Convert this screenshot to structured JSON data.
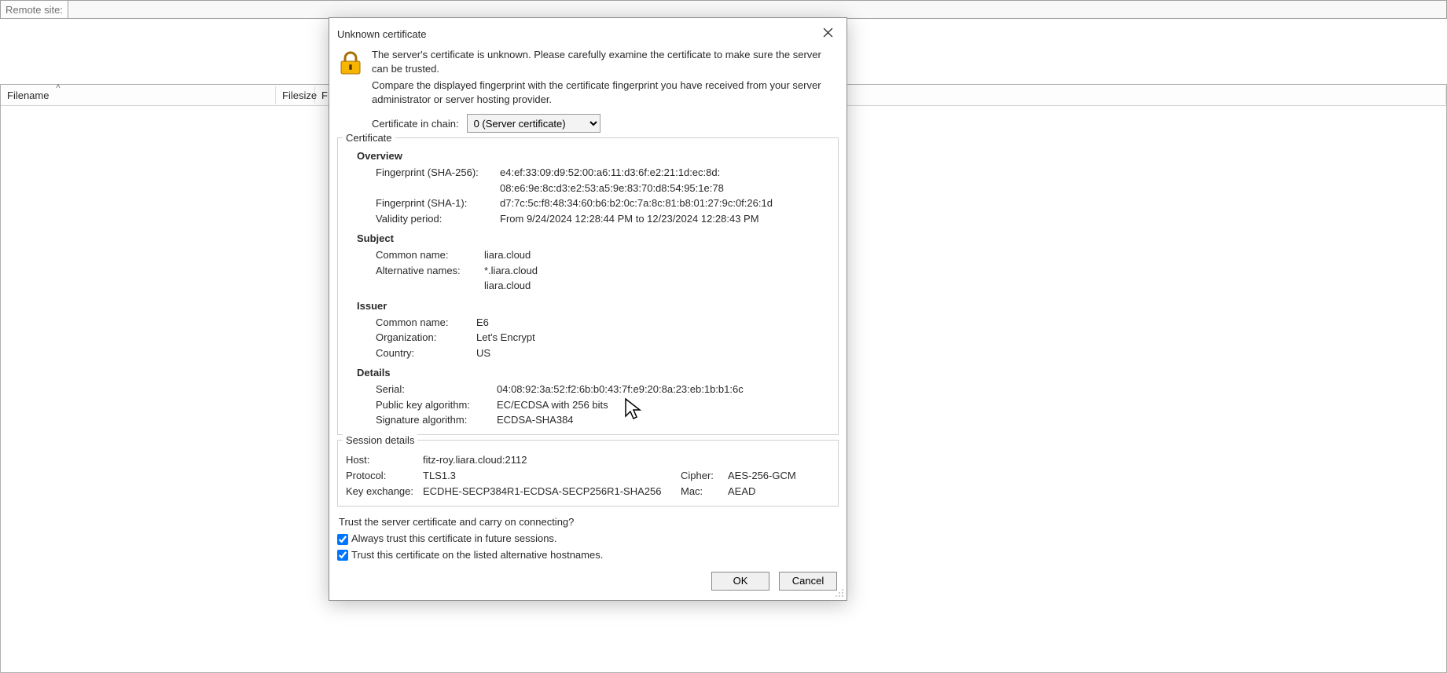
{
  "remote_site_label": "Remote site:",
  "columns": {
    "filename": "Filename",
    "filesize": "Filesize",
    "f": "F"
  },
  "dialog_title": "Unknown certificate",
  "warning_line1": "The server's certificate is unknown. Please carefully examine the certificate to make sure the server can be trusted.",
  "warning_line2": "Compare the displayed fingerprint with the certificate fingerprint you have received from your server administrator or server hosting provider.",
  "chain_label": "Certificate in chain:",
  "chain_select": "0 (Server certificate)",
  "cert_legend": "Certificate",
  "overview_title": "Overview",
  "fp256_label": "Fingerprint (SHA-256):",
  "fp256_line1": "e4:ef:33:09:d9:52:00:a6:11:d3:6f:e2:21:1d:ec:8d:",
  "fp256_line2": "08:e6:9e:8c:d3:e2:53:a5:9e:83:70:d8:54:95:1e:78",
  "fp1_label": "Fingerprint (SHA-1):",
  "fp1_value": "d7:7c:5c:f8:48:34:60:b6:b2:0c:7a:8c:81:b8:01:27:9c:0f:26:1d",
  "validity_label": "Validity period:",
  "validity_value": "From 9/24/2024 12:28:44 PM to 12/23/2024 12:28:43 PM",
  "subject_title": "Subject",
  "subj_cn_label": "Common name:",
  "subj_cn_value": "liara.cloud",
  "subj_alt_label": "Alternative names:",
  "subj_alt_line1": "*.liara.cloud",
  "subj_alt_line2": "liara.cloud",
  "issuer_title": "Issuer",
  "iss_cn_label": "Common name:",
  "iss_cn_value": "E6",
  "iss_org_label": "Organization:",
  "iss_org_value": "Let's Encrypt",
  "iss_country_label": "Country:",
  "iss_country_value": "US",
  "details_title": "Details",
  "serial_label": "Serial:",
  "serial_value": "04:08:92:3a:52:f2:6b:b0:43:7f:e9:20:8a:23:eb:1b:b1:6c",
  "pkalg_label": "Public key algorithm:",
  "pkalg_value": "EC/ECDSA with 256 bits",
  "sigalg_label": "Signature algorithm:",
  "sigalg_value": "ECDSA-SHA384",
  "session_legend": "Session details",
  "host_label": "Host:",
  "host_value": "fitz-roy.liara.cloud:2112",
  "proto_label": "Protocol:",
  "proto_value": "TLS1.3",
  "cipher_label": "Cipher:",
  "cipher_value": "AES-256-GCM",
  "kex_label": "Key exchange:",
  "kex_value": "ECDHE-SECP384R1-ECDSA-SECP256R1-SHA256",
  "mac_label": "Mac:",
  "mac_value": "AEAD",
  "trust_question": "Trust the server certificate and carry on connecting?",
  "chk_always": "Always trust this certificate in future sessions.",
  "chk_alt": "Trust this certificate on the listed alternative hostnames.",
  "ok_label": "OK",
  "cancel_label": "Cancel"
}
